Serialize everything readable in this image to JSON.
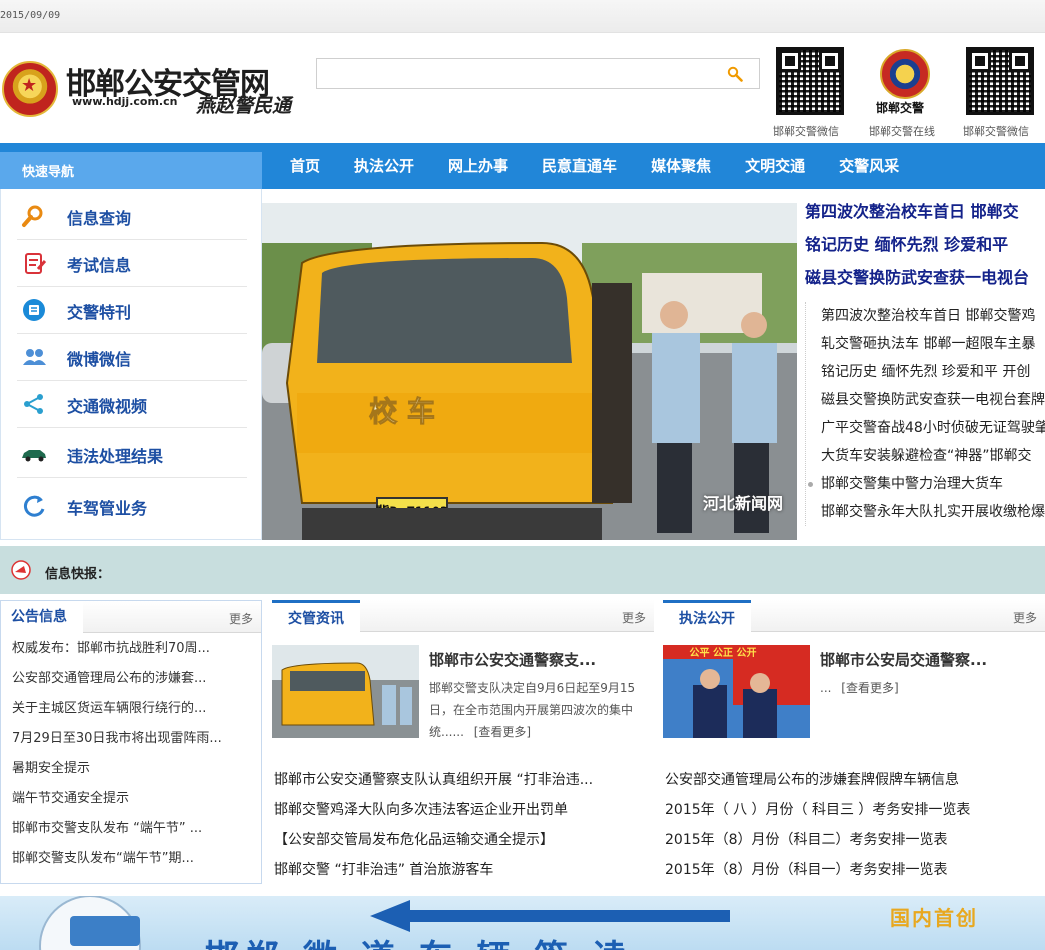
{
  "topbar": {
    "date": "2015/09/09"
  },
  "header": {
    "site_title": "邯郸公安交管网",
    "site_url": "www.hdjj.com.cn",
    "slogan": "燕赵警民通",
    "search": {
      "placeholder": "",
      "value": ""
    },
    "qr_captions": [
      "邯郸交警微信",
      "邯郸交警在线",
      "邯郸交警微信"
    ],
    "badge_text": "邯郸交警"
  },
  "nav": {
    "quick_nav_label": "快速导航",
    "items": [
      "首页",
      "执法公开",
      "网上办事",
      "民意直通车",
      "媒体聚焦",
      "文明交通",
      "交警风采"
    ]
  },
  "side_menu": {
    "items": [
      {
        "label": "信息查询",
        "icon": "search-icon"
      },
      {
        "label": "考试信息",
        "icon": "exam-icon"
      },
      {
        "label": "交警特刊",
        "icon": "journal-icon"
      },
      {
        "label": "微博微信",
        "icon": "users-icon"
      },
      {
        "label": "交通微视频",
        "icon": "share-icon"
      },
      {
        "label": "违法处理结果",
        "icon": "car-icon"
      },
      {
        "label": "车驾管业务",
        "icon": "refresh-icon"
      }
    ]
  },
  "hero": {
    "watermark": "河北新闻网",
    "plate_text": "冀D Z1102",
    "bus_text": "校 车"
  },
  "headlines": [
    "第四波次整治校车首日  邯郸交",
    "铭记历史  缅怀先烈  珍爱和平",
    "磁县交警换防武安查获一电视台"
  ],
  "side_news": [
    "第四波次整治校车首日  邯郸交警鸡",
    "轧交警砸执法车  邯郸一超限车主暴",
    "铭记历史  缅怀先烈  珍爱和平  开创",
    "磁县交警换防武安查获一电视台套牌",
    "广平交警奋战48小时侦破无证驾驶肇",
    "大货车安装躲避检查“神器”邯郸交",
    "邯郸交警集中警力治理大货车",
    "邯郸交警永年大队扎实开展收缴枪爆"
  ],
  "ticker": {
    "label": "信息快报："
  },
  "notice": {
    "title": "公告信息",
    "more": "更多",
    "items": [
      "权威发布：邯郸市抗战胜利70周...",
      "公安部交通管理局公布的涉嫌套...",
      "关于主城区货运车辆限行绕行的...",
      "7月29日至30日我市将出现雷阵雨...",
      "暑期安全提示",
      "端午节交通安全提示",
      "邯郸市交警支队发布 “端午节” ...",
      "邯郸交警支队发布“端午节”期..."
    ]
  },
  "news": {
    "title": "交管资讯",
    "more": "更多",
    "feature_title": "邯郸市公安交通警察支...",
    "feature_desc": "邯郸交警支队决定自9月6日起至9月15日，在全市范围内开展第四波次的集中统......",
    "feature_more": "[查看更多]",
    "items": [
      "邯郸市公安交通警察支队认真组织开展 “打非治违...",
      "邯郸交警鸡泽大队向多次违法客运企业开出罚单",
      "【公安部交管局发布危化品运输交通全提示】",
      "邯郸交警 “打非治违” 首治旅游客车"
    ]
  },
  "law": {
    "title": "执法公开",
    "more": "更多",
    "feature_title": "邯郸市公安局交通警察...",
    "feature_desc": "...",
    "feature_more": "[查看更多]",
    "image_text": "公平  公正  公开",
    "items": [
      "公安部交通管理局公布的涉嫌套牌假牌车辆信息",
      "2015年（ 八 ）月份（ 科目三 ）考务安排一览表",
      "2015年（8）月份（科目二）考务安排一览表",
      "2015年（8）月份（科目一）考务安排一览表"
    ]
  },
  "banner": {
    "text_a": "邯郸 微 道 车 辆 签 读",
    "text_b": "国内首创"
  },
  "colors": {
    "nav_blue": "#2186d8",
    "quick_nav": "#5aa8ec",
    "headline_blue": "#13228a",
    "ticker_bg": "#c8dede"
  }
}
